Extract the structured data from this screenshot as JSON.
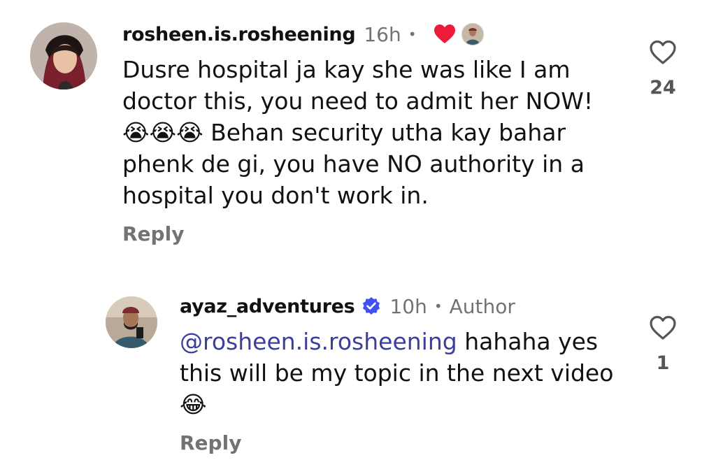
{
  "comments": [
    {
      "username": "rosheen.is.rosheening",
      "time": "16h",
      "text": "Dusre hospital ja kay she was like I am doctor this, you need to admit her NOW! 😭😭😭 Behan security utha kay bahar phenk de gi, you have NO authority in a hospital you don't work in.",
      "reply_label": "Reply",
      "like_count": "24",
      "liked_by_author": true,
      "icons": {
        "like": "heart-outline-icon",
        "author_like": "heart-filled-icon"
      },
      "colors": {
        "author_heart": "#ed1b3a"
      }
    },
    {
      "username": "ayaz_adventures",
      "time": "10h",
      "author_label": "Author",
      "mention": "@rosheen.is.rosheening",
      "text": "hahaha yes this will be my topic in the next video 😂",
      "reply_label": "Reply",
      "like_count": "1",
      "icons": {
        "verified": "verified-badge-icon",
        "like": "heart-outline-icon"
      },
      "colors": {
        "verified": "#3f51f5",
        "mention": "#3a3f9e"
      }
    }
  ],
  "colors": {
    "meta_gray": "#737373",
    "text": "#111111"
  }
}
